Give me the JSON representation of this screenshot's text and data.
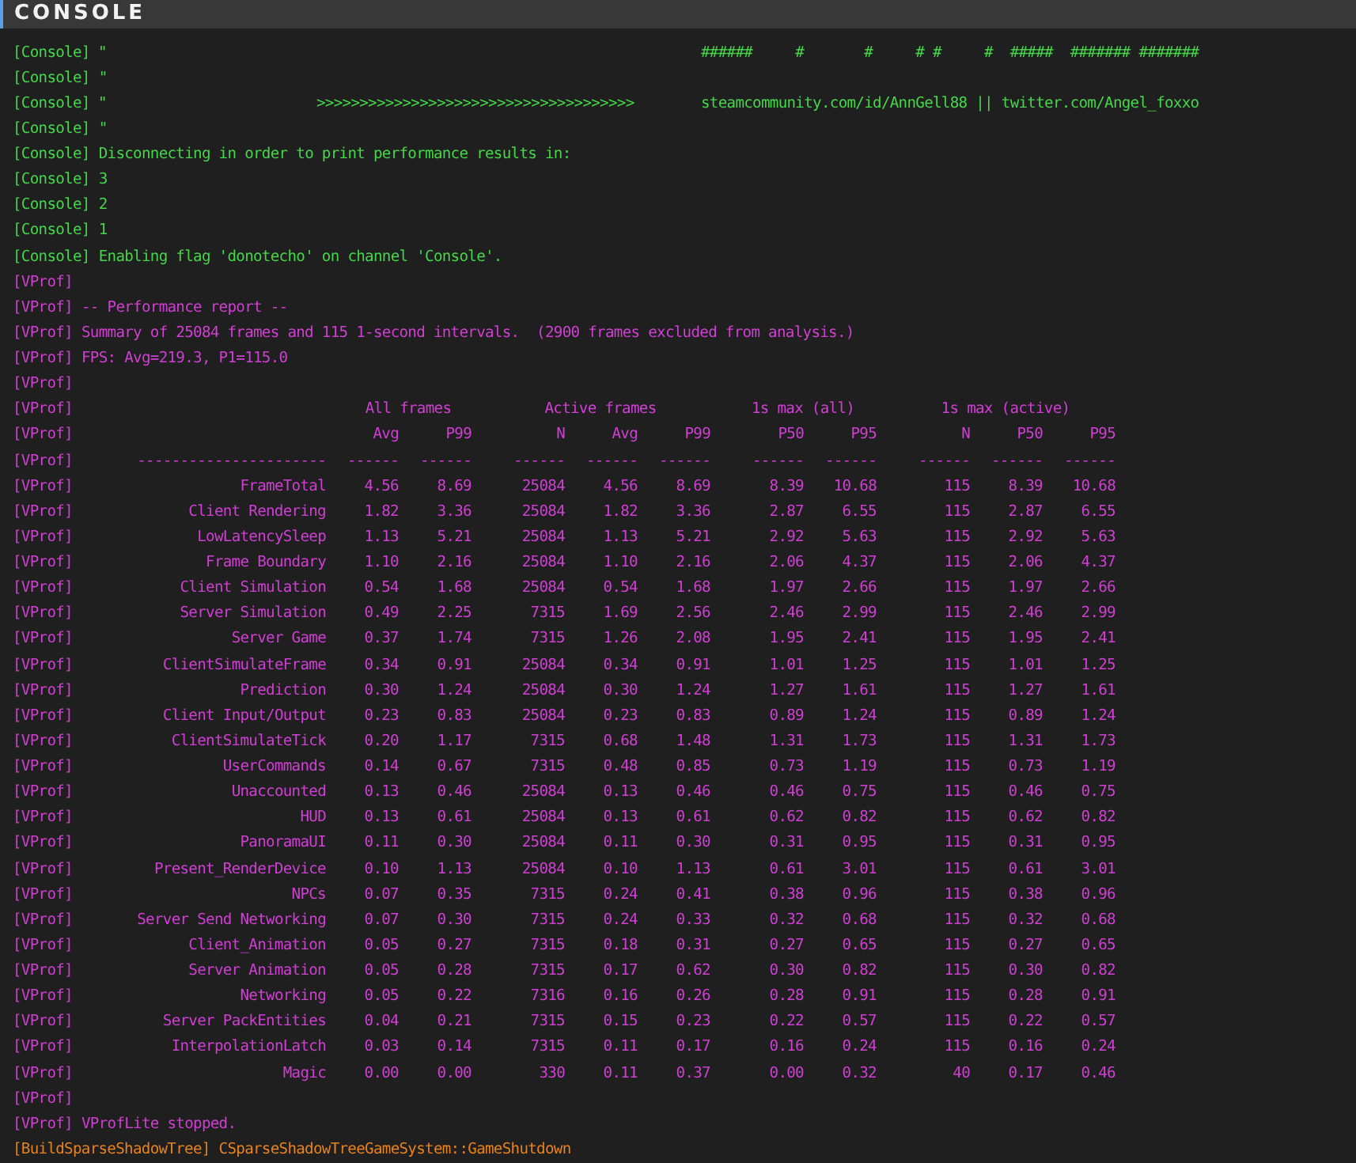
{
  "title": "CONSOLE",
  "lines": [
    {
      "kind": "banner",
      "color": "#45d64a",
      "tag": "[Console]",
      "quote": "\"",
      "right": "######     #       #     # #     #  #####  ####### #######"
    },
    {
      "kind": "text",
      "color": "#45d64a",
      "tag": "[Console]",
      "text": "\""
    },
    {
      "kind": "banner",
      "color": "#45d64a",
      "tag": "[Console]",
      "quote": "\"",
      "middle": ">>>>>>>>>>>>>>>>>>>>>>>>>>>>>>>>>>>>>",
      "right": "steamcommunity.com/id/AnnGell88 || twitter.com/Angel_foxxo"
    },
    {
      "kind": "text",
      "color": "#45d64a",
      "tag": "[Console]",
      "text": "\""
    },
    {
      "kind": "text",
      "color": "#45d64a",
      "tag": "[Console]",
      "text": "Disconnecting in order to print performance results in:"
    },
    {
      "kind": "text",
      "color": "#45d64a",
      "tag": "[Console]",
      "text": "3"
    },
    {
      "kind": "text",
      "color": "#45d64a",
      "tag": "[Console]",
      "text": "2"
    },
    {
      "kind": "text",
      "color": "#45d64a",
      "tag": "[Console]",
      "text": "1"
    },
    {
      "kind": "text",
      "color": "#45d64a",
      "tag": "[Console]",
      "text": "Enabling flag 'donotecho' on channel 'Console'."
    },
    {
      "kind": "text",
      "color": "#d03fd3",
      "tag": "[VProf]"
    },
    {
      "kind": "text",
      "color": "#d03fd3",
      "tag": "[VProf]",
      "text": "-- Performance report --"
    },
    {
      "kind": "text",
      "color": "#d03fd3",
      "tag": "[VProf]",
      "text": "Summary of 25084 frames and 115 1-second intervals.  (2900 frames excluded from analysis.)"
    },
    {
      "kind": "text",
      "color": "#d03fd3",
      "tag": "[VProf]",
      "text": "FPS: Avg=219.3, P1=115.0"
    },
    {
      "kind": "text",
      "color": "#d03fd3",
      "tag": "[VProf]"
    },
    {
      "kind": "groups",
      "color": "#d03fd3",
      "tag": "[VProf]",
      "groups": [
        "All frames",
        "Active frames",
        "1s max (all)",
        "1s max (active)"
      ]
    },
    {
      "kind": "columns",
      "color": "#d03fd3",
      "tag": "[VProf]",
      "cells": [
        "Avg",
        "P99",
        "N",
        "Avg",
        "P99",
        "P50",
        "P95",
        "N",
        "P50",
        "P95"
      ]
    },
    {
      "kind": "rule",
      "color": "#d03fd3",
      "tag": "[VProf]",
      "name": "----------------------",
      "cells": [
        "------",
        "------",
        "------",
        "------",
        "------",
        "------",
        "------",
        "------",
        "------",
        "------"
      ]
    },
    {
      "kind": "row",
      "color": "#d03fd3",
      "tag": "[VProf]",
      "name": "FrameTotal",
      "cells": [
        "4.56",
        "8.69",
        "25084",
        "4.56",
        "8.69",
        "8.39",
        "10.68",
        "115",
        "8.39",
        "10.68"
      ]
    },
    {
      "kind": "row",
      "color": "#d03fd3",
      "tag": "[VProf]",
      "name": "Client Rendering",
      "cells": [
        "1.82",
        "3.36",
        "25084",
        "1.82",
        "3.36",
        "2.87",
        "6.55",
        "115",
        "2.87",
        "6.55"
      ]
    },
    {
      "kind": "row",
      "color": "#d03fd3",
      "tag": "[VProf]",
      "name": "LowLatencySleep",
      "cells": [
        "1.13",
        "5.21",
        "25084",
        "1.13",
        "5.21",
        "2.92",
        "5.63",
        "115",
        "2.92",
        "5.63"
      ]
    },
    {
      "kind": "row",
      "color": "#d03fd3",
      "tag": "[VProf]",
      "name": "Frame Boundary",
      "cells": [
        "1.10",
        "2.16",
        "25084",
        "1.10",
        "2.16",
        "2.06",
        "4.37",
        "115",
        "2.06",
        "4.37"
      ]
    },
    {
      "kind": "row",
      "color": "#d03fd3",
      "tag": "[VProf]",
      "name": "Client Simulation",
      "cells": [
        "0.54",
        "1.68",
        "25084",
        "0.54",
        "1.68",
        "1.97",
        "2.66",
        "115",
        "1.97",
        "2.66"
      ]
    },
    {
      "kind": "row",
      "color": "#d03fd3",
      "tag": "[VProf]",
      "name": "Server Simulation",
      "cells": [
        "0.49",
        "2.25",
        "7315",
        "1.69",
        "2.56",
        "2.46",
        "2.99",
        "115",
        "2.46",
        "2.99"
      ]
    },
    {
      "kind": "row",
      "color": "#d03fd3",
      "tag": "[VProf]",
      "name": "Server Game",
      "cells": [
        "0.37",
        "1.74",
        "7315",
        "1.26",
        "2.08",
        "1.95",
        "2.41",
        "115",
        "1.95",
        "2.41"
      ]
    },
    {
      "kind": "row",
      "color": "#d03fd3",
      "tag": "[VProf]",
      "name": "ClientSimulateFrame",
      "cells": [
        "0.34",
        "0.91",
        "25084",
        "0.34",
        "0.91",
        "1.01",
        "1.25",
        "115",
        "1.01",
        "1.25"
      ]
    },
    {
      "kind": "row",
      "color": "#d03fd3",
      "tag": "[VProf]",
      "name": "Prediction",
      "cells": [
        "0.30",
        "1.24",
        "25084",
        "0.30",
        "1.24",
        "1.27",
        "1.61",
        "115",
        "1.27",
        "1.61"
      ]
    },
    {
      "kind": "row",
      "color": "#d03fd3",
      "tag": "[VProf]",
      "name": "Client Input/Output",
      "cells": [
        "0.23",
        "0.83",
        "25084",
        "0.23",
        "0.83",
        "0.89",
        "1.24",
        "115",
        "0.89",
        "1.24"
      ]
    },
    {
      "kind": "row",
      "color": "#d03fd3",
      "tag": "[VProf]",
      "name": "ClientSimulateTick",
      "cells": [
        "0.20",
        "1.17",
        "7315",
        "0.68",
        "1.48",
        "1.31",
        "1.73",
        "115",
        "1.31",
        "1.73"
      ]
    },
    {
      "kind": "row",
      "color": "#d03fd3",
      "tag": "[VProf]",
      "name": "UserCommands",
      "cells": [
        "0.14",
        "0.67",
        "7315",
        "0.48",
        "0.85",
        "0.73",
        "1.19",
        "115",
        "0.73",
        "1.19"
      ]
    },
    {
      "kind": "row",
      "color": "#d03fd3",
      "tag": "[VProf]",
      "name": "Unaccounted",
      "cells": [
        "0.13",
        "0.46",
        "25084",
        "0.13",
        "0.46",
        "0.46",
        "0.75",
        "115",
        "0.46",
        "0.75"
      ]
    },
    {
      "kind": "row",
      "color": "#d03fd3",
      "tag": "[VProf]",
      "name": "HUD",
      "cells": [
        "0.13",
        "0.61",
        "25084",
        "0.13",
        "0.61",
        "0.62",
        "0.82",
        "115",
        "0.62",
        "0.82"
      ]
    },
    {
      "kind": "row",
      "color": "#d03fd3",
      "tag": "[VProf]",
      "name": "PanoramaUI",
      "cells": [
        "0.11",
        "0.30",
        "25084",
        "0.11",
        "0.30",
        "0.31",
        "0.95",
        "115",
        "0.31",
        "0.95"
      ]
    },
    {
      "kind": "row",
      "color": "#d03fd3",
      "tag": "[VProf]",
      "name": "Present_RenderDevice",
      "cells": [
        "0.10",
        "1.13",
        "25084",
        "0.10",
        "1.13",
        "0.61",
        "3.01",
        "115",
        "0.61",
        "3.01"
      ]
    },
    {
      "kind": "row",
      "color": "#d03fd3",
      "tag": "[VProf]",
      "name": "NPCs",
      "cells": [
        "0.07",
        "0.35",
        "7315",
        "0.24",
        "0.41",
        "0.38",
        "0.96",
        "115",
        "0.38",
        "0.96"
      ]
    },
    {
      "kind": "row",
      "color": "#d03fd3",
      "tag": "[VProf]",
      "name": "Server Send Networking",
      "cells": [
        "0.07",
        "0.30",
        "7315",
        "0.24",
        "0.33",
        "0.32",
        "0.68",
        "115",
        "0.32",
        "0.68"
      ]
    },
    {
      "kind": "row",
      "color": "#d03fd3",
      "tag": "[VProf]",
      "name": "Client_Animation",
      "cells": [
        "0.05",
        "0.27",
        "7315",
        "0.18",
        "0.31",
        "0.27",
        "0.65",
        "115",
        "0.27",
        "0.65"
      ]
    },
    {
      "kind": "row",
      "color": "#d03fd3",
      "tag": "[VProf]",
      "name": "Server Animation",
      "cells": [
        "0.05",
        "0.28",
        "7315",
        "0.17",
        "0.62",
        "0.30",
        "0.82",
        "115",
        "0.30",
        "0.82"
      ]
    },
    {
      "kind": "row",
      "color": "#d03fd3",
      "tag": "[VProf]",
      "name": "Networking",
      "cells": [
        "0.05",
        "0.22",
        "7316",
        "0.16",
        "0.26",
        "0.28",
        "0.91",
        "115",
        "0.28",
        "0.91"
      ]
    },
    {
      "kind": "row",
      "color": "#d03fd3",
      "tag": "[VProf]",
      "name": "Server PackEntities",
      "cells": [
        "0.04",
        "0.21",
        "7315",
        "0.15",
        "0.23",
        "0.22",
        "0.57",
        "115",
        "0.22",
        "0.57"
      ]
    },
    {
      "kind": "row",
      "color": "#d03fd3",
      "tag": "[VProf]",
      "name": "InterpolationLatch",
      "cells": [
        "0.03",
        "0.14",
        "7315",
        "0.11",
        "0.17",
        "0.16",
        "0.24",
        "115",
        "0.16",
        "0.24"
      ]
    },
    {
      "kind": "row",
      "color": "#d03fd3",
      "tag": "[VProf]",
      "name": "Magic",
      "cells": [
        "0.00",
        "0.00",
        "330",
        "0.11",
        "0.37",
        "0.00",
        "0.32",
        "40",
        "0.17",
        "0.46"
      ]
    },
    {
      "kind": "text",
      "color": "#d03fd3",
      "tag": "[VProf]"
    },
    {
      "kind": "text",
      "color": "#d03fd3",
      "tag": "[VProf]",
      "text": "VProfLite stopped."
    },
    {
      "kind": "text",
      "color": "#e8821e",
      "tag": "[BuildSparseShadowTree]",
      "text": "CSparseShadowTreeGameSystem::GameShutdown"
    }
  ]
}
